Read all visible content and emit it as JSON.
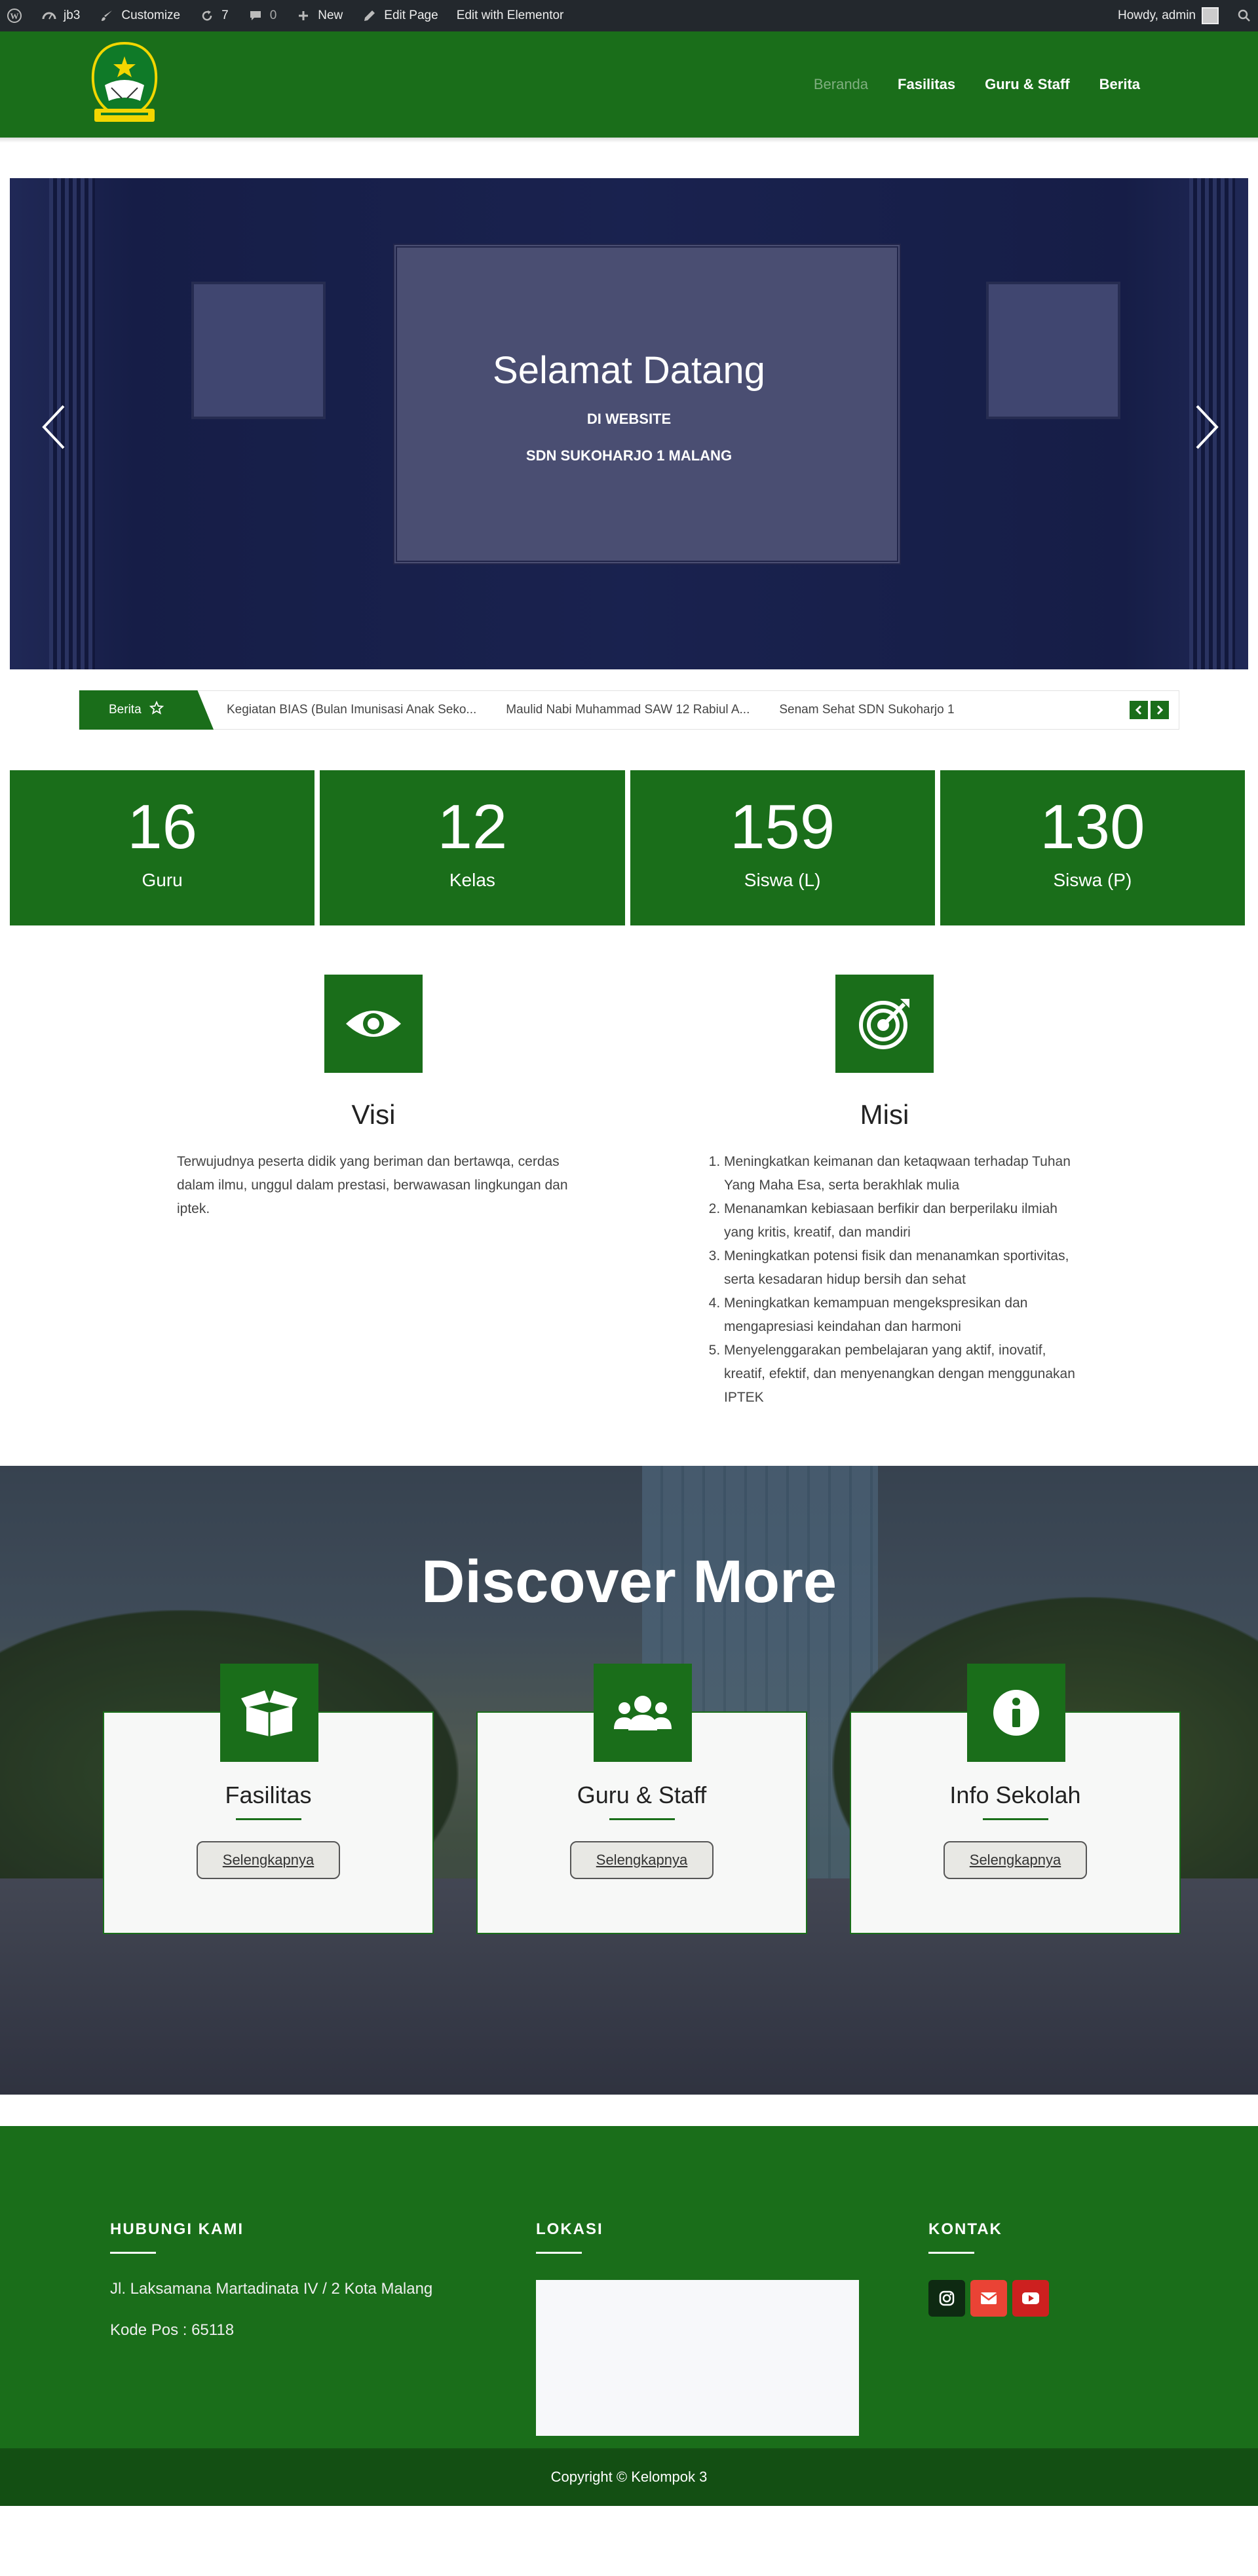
{
  "admin_bar": {
    "site": "jb3",
    "customize": "Customize",
    "updates": "7",
    "comments": "0",
    "new": "New",
    "edit_page": "Edit Page",
    "edit_elementor": "Edit with Elementor",
    "howdy": "Howdy, admin"
  },
  "nav": {
    "items": [
      "Beranda",
      "Fasilitas",
      "Guru & Staff",
      "Berita"
    ],
    "active": "Beranda"
  },
  "hero": {
    "title": "Selamat Datang",
    "line1": "DI WEBSITE",
    "line2": "SDN SUKOHARJO 1 MALANG"
  },
  "ticker": {
    "label": "Berita",
    "items": [
      "Kegiatan BIAS (Bulan Imunisasi Anak Seko...",
      "Maulid Nabi Muhammad SAW 12 Rabiul A...",
      "Senam Sehat SDN Sukoharjo 1"
    ]
  },
  "stats": [
    {
      "value": "16",
      "label": "Guru"
    },
    {
      "value": "12",
      "label": "Kelas"
    },
    {
      "value": "159",
      "label": "Siswa (L)"
    },
    {
      "value": "130",
      "label": "Siswa (P)"
    }
  ],
  "visi": {
    "title": "Visi",
    "text": "Terwujudnya peserta didik yang beriman dan bertawqa, cerdas dalam ilmu, unggul dalam prestasi, berwawasan lingkungan dan iptek."
  },
  "misi": {
    "title": "Misi",
    "items": [
      "Meningkatkan keimanan dan ketaqwaan terhadap Tuhan Yang Maha Esa, serta berakhlak mulia",
      "Menanamkan kebiasaan berfikir dan berperilaku ilmiah yang kritis, kreatif, dan mandiri",
      "Meningkatkan potensi fisik dan menanamkan sportivitas, serta kesadaran hidup bersih dan sehat",
      "Meningkatkan kemampuan mengekspresikan dan mengapresiasi keindahan dan harmoni",
      "Menyelenggarakan pembelajaran yang aktif, inovatif, kreatif, efektif, dan menyenangkan dengan menggunakan IPTEK"
    ]
  },
  "discover": {
    "title": "Discover More",
    "cards": [
      {
        "title": "Fasilitas",
        "button": "Selengkapnya",
        "icon": "box-open-icon"
      },
      {
        "title": "Guru & Staff",
        "button": "Selengkapnya",
        "icon": "users-icon"
      },
      {
        "title": "Info Sekolah",
        "button": "Selengkapnya",
        "icon": "info-circle-icon"
      }
    ]
  },
  "footer": {
    "hubungi_title": "HUBUNGI KAMI",
    "address": "Jl. Laksamana Martadinata IV / 2 Kota Malang",
    "postal": "Kode Pos : 65118",
    "lokasi_title": "LOKASI",
    "kontak_title": "KONTAK",
    "socials": [
      "instagram-icon",
      "email-icon",
      "youtube-icon"
    ],
    "copyright": "Copyright © Kelompok 3"
  },
  "colors": {
    "primary_green": "#1a6e1a",
    "dark_green": "#134f13",
    "admin_bar": "#23282d"
  }
}
